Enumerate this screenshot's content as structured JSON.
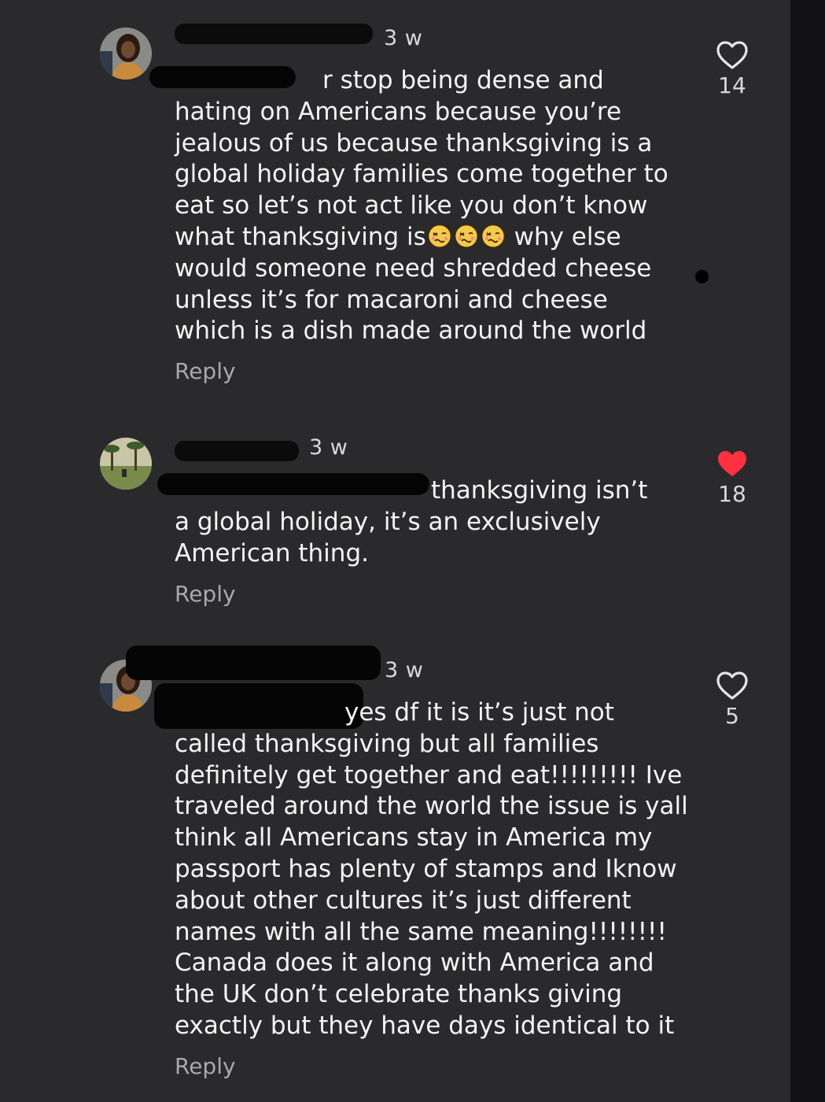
{
  "comments": [
    {
      "time": "3 w",
      "text_a": "r stop being dense and\nhating on Americans because you’re\njealous of us because thanksgiving is a\nglobal holiday families come together to\neat so let’s not act like you don’t know\nwhat thanksgiving is",
      "text_b": " why else\nwould someone need shredded cheese\nunless it’s for macaroni and cheese\nwhich is a dish made around the world",
      "emoji_name": "woozy-face-icon",
      "reply": "Reply",
      "likes": "14",
      "liked": false
    },
    {
      "time": "3 w",
      "text_a": "thanksgiving isn’t\na global holiday, it’s an exclusively\nAmerican thing.",
      "text_b": "",
      "reply": "Reply",
      "likes": "18",
      "liked": true
    },
    {
      "time": "3 w",
      "text_a": "yes df it is it’s just not\ncalled thanksgiving but all families\ndefinitely get together and eat!!!!!!!!! Ive\ntraveled around the world the issue is yall\nthink all Americans stay in America my\npassport has plenty of stamps and Iknow\nabout other cultures it’s just different\nnames with all the same meaning!!!!!!!!\nCanada does it along with America and\nthe UK don’t celebrate thanks giving\nexactly but they have days identical to it",
      "text_b": "",
      "reply": "Reply",
      "likes": "5",
      "liked": false
    }
  ],
  "colors": {
    "background": "#2a2a2c",
    "text": "#f4f4f4",
    "muted": "#a9a9ad",
    "like_active": "#ff3040"
  }
}
